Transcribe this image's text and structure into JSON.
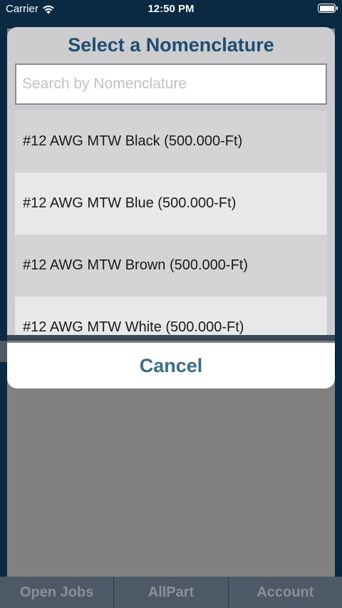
{
  "status_bar": {
    "carrier": "Carrier",
    "time": "12:50 PM",
    "icons": [
      "wifi-icon",
      "battery-icon"
    ]
  },
  "modal": {
    "title": "Select a Nomenclature",
    "search": {
      "placeholder": "Search by Nomenclature",
      "value": ""
    },
    "items": [
      {
        "label": "#12 AWG MTW Black (500.000-Ft)"
      },
      {
        "label": "#12 AWG MTW Blue (500.000-Ft)"
      },
      {
        "label": "#12 AWG MTW Brown (500.000-Ft)"
      },
      {
        "label": "#12 AWG MTW White (500.000-Ft)"
      }
    ],
    "cancel_label": "Cancel"
  },
  "tab_bar": {
    "tabs": [
      {
        "label": "Open Jobs"
      },
      {
        "label": "AllPart"
      },
      {
        "label": "Account"
      }
    ]
  },
  "colors": {
    "navy": "#0f3a5e",
    "title": "#1e4d72",
    "cancel": "#3b6c8a"
  }
}
